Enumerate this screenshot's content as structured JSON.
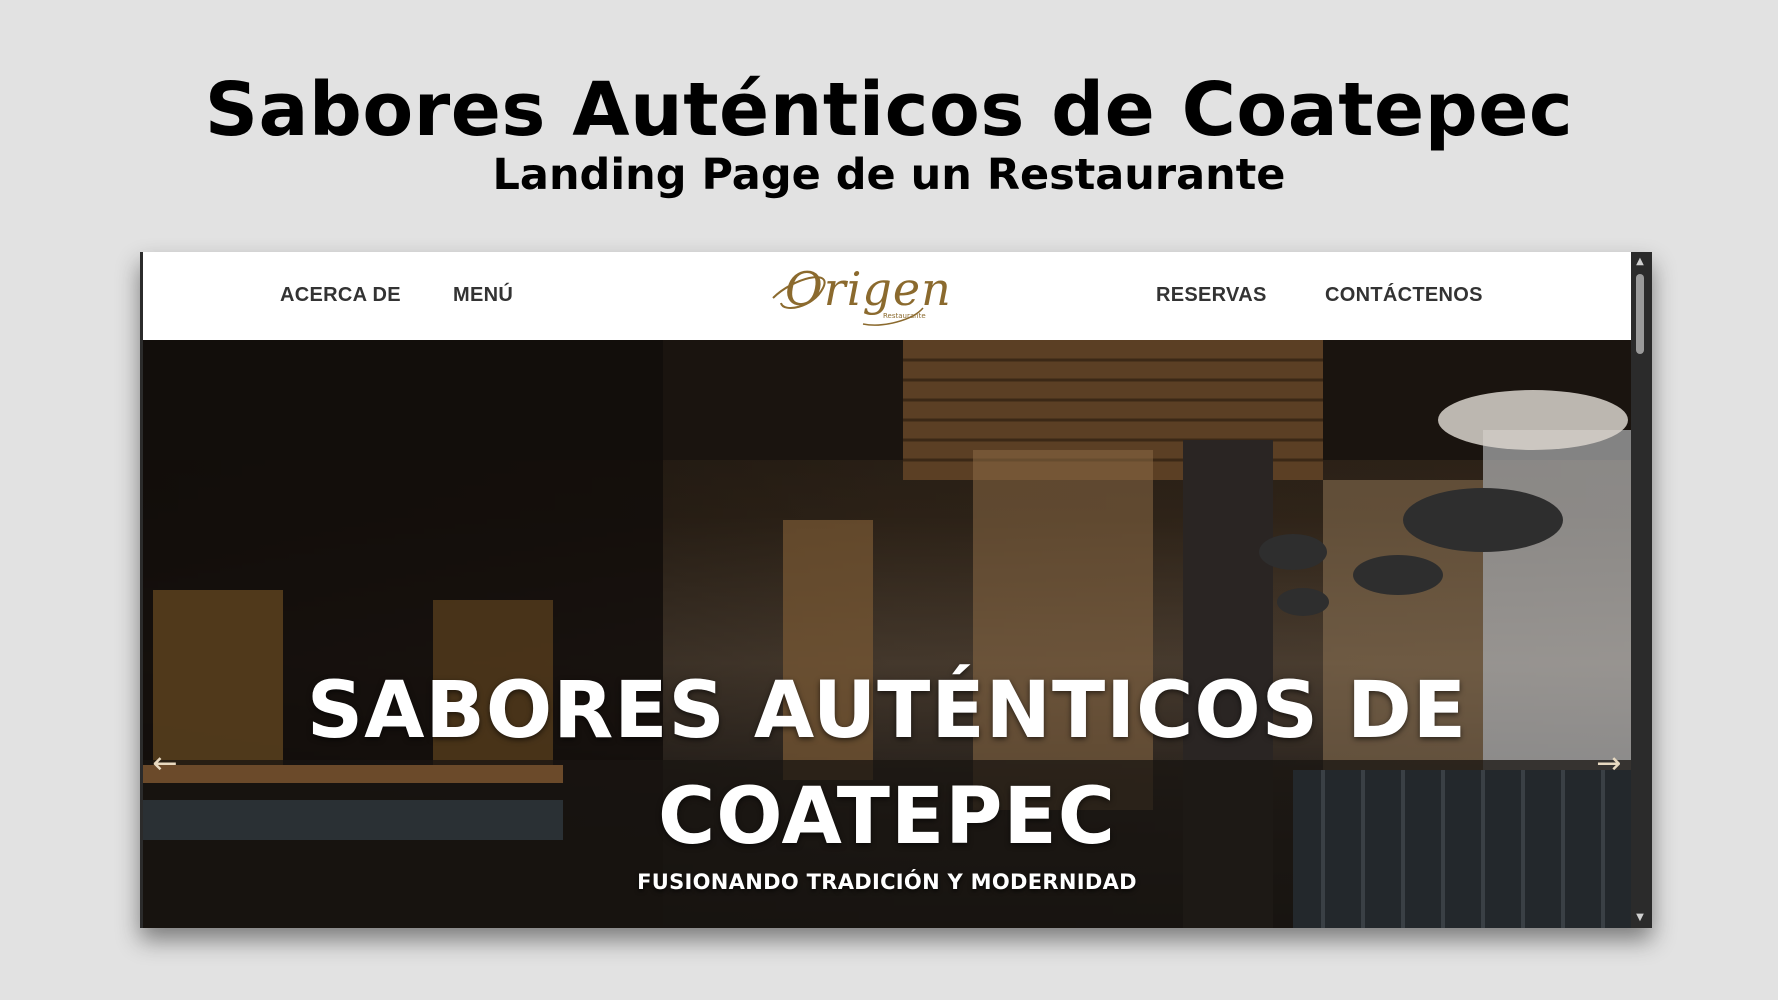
{
  "slide": {
    "title": "Sabores Auténticos de Coatepec",
    "subtitle": "Landing Page de un Restaurante"
  },
  "navbar": {
    "links": [
      "ACERCA DE",
      "MENÚ",
      "RESERVAS",
      "CONTÁCTENOS"
    ],
    "logo_text": "Origen",
    "logo_sub": "Restaurante"
  },
  "hero": {
    "title_line1": "SABORES AUTÉNTICOS DE",
    "title_line2": "COATEPEC",
    "tagline": "FUSIONANDO TRADICIÓN Y MODERNIDAD",
    "prev_icon": "arrow-left-icon",
    "next_icon": "arrow-right-icon"
  },
  "colors": {
    "background": "#e2e2e2",
    "navbar": "#ffffff",
    "logo_gold": "#8b6a2e",
    "nav_text": "#333333"
  }
}
